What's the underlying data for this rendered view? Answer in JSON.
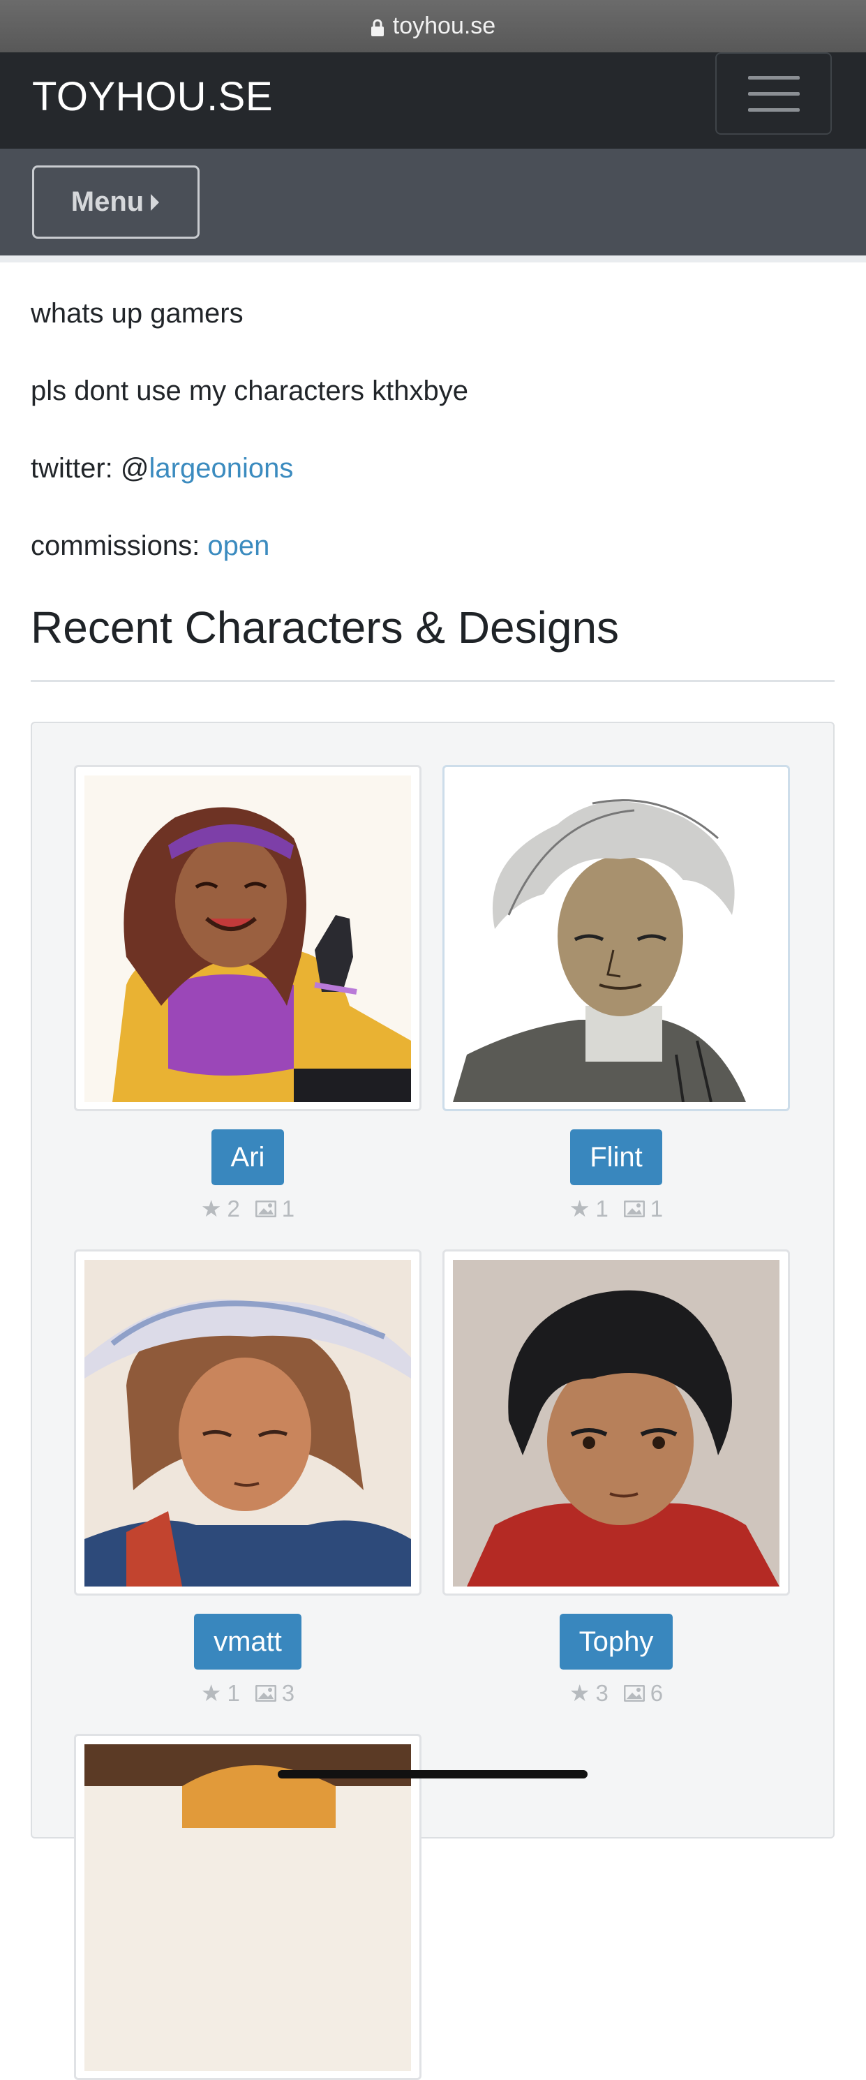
{
  "browser": {
    "url": "toyhou.se"
  },
  "navbar": {
    "brand": "TOYHOU.SE",
    "toggle_icon": "hamburger-icon"
  },
  "submenu": {
    "menu_label": "Menu"
  },
  "bio": {
    "line1": "whats up gamers",
    "line2": "pls dont use my characters kthxbye",
    "twitter_prefix": "twitter: @",
    "twitter_handle": "largeonions",
    "commissions_prefix": "commissions: ",
    "commissions_status": "open"
  },
  "section": {
    "title": "Recent Characters & Designs"
  },
  "characters": [
    {
      "name": "Ari",
      "favorites": "2",
      "images": "1"
    },
    {
      "name": "Flint",
      "favorites": "1",
      "images": "1"
    },
    {
      "name": "vmatt",
      "favorites": "1",
      "images": "3"
    },
    {
      "name": "Tophy",
      "favorites": "3",
      "images": "6"
    }
  ],
  "colors": {
    "accent": "#3987be",
    "link": "#3b8bbf",
    "navbar": "#25282c",
    "subbar": "#4a4f57"
  }
}
